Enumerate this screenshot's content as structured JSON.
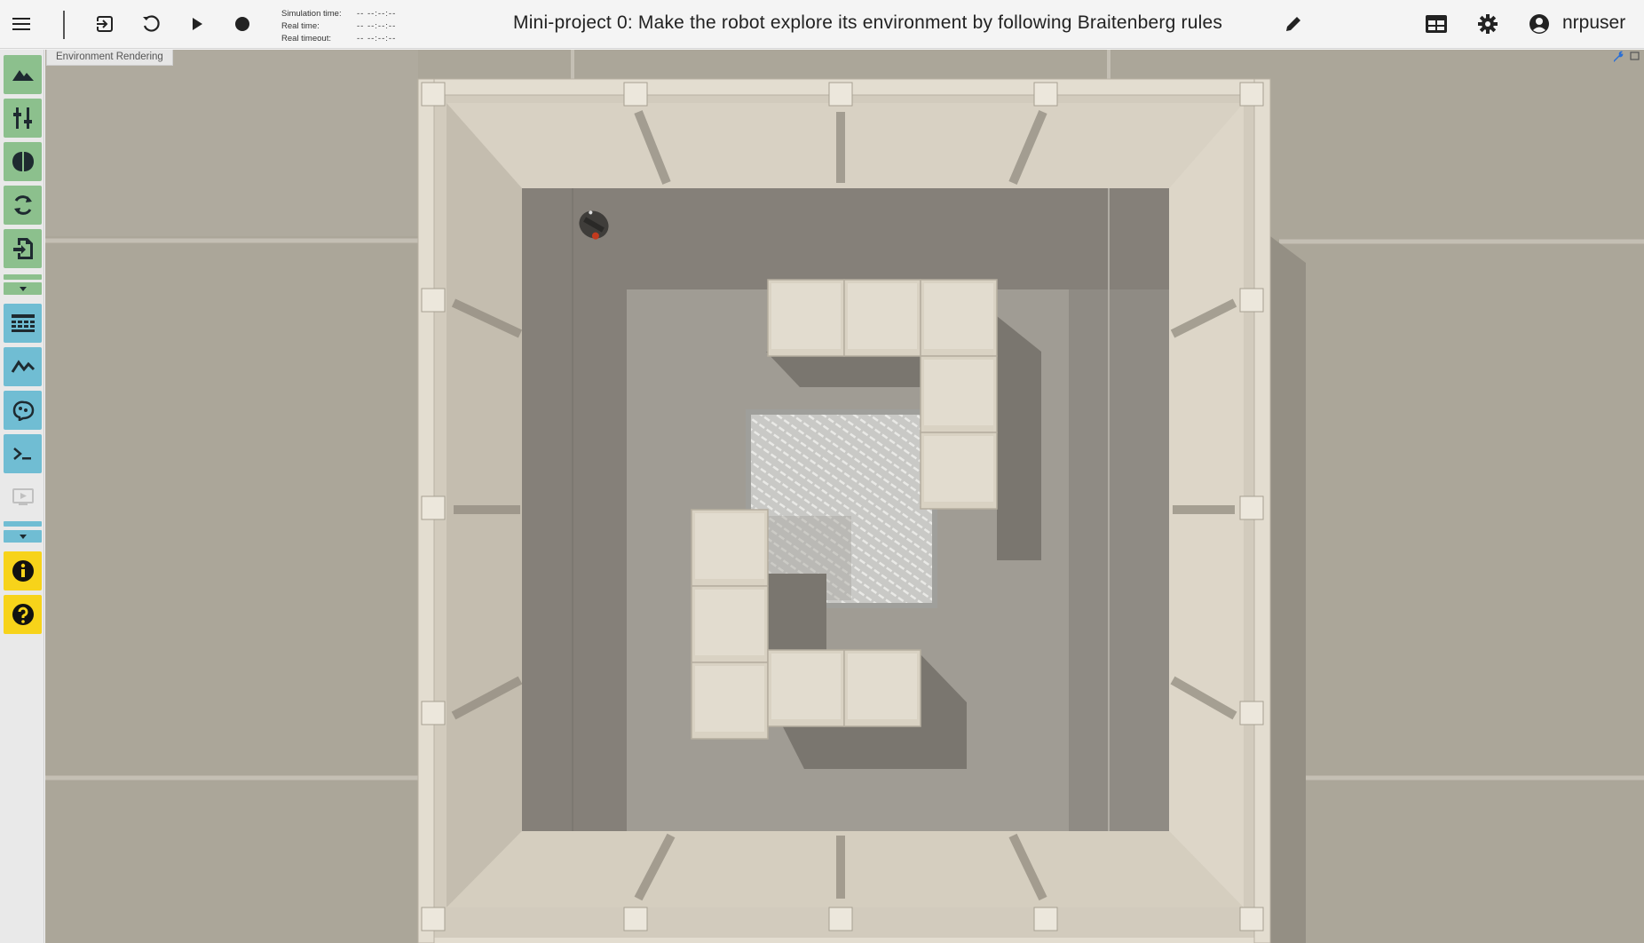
{
  "toolbar": {
    "menu_icon": "menu-icon",
    "exit_icon": "exit-icon",
    "reset_icon": "reset-icon",
    "play_icon": "play-icon",
    "record_icon": "record-icon"
  },
  "timers": {
    "simulation_label": "Simulation time:",
    "simulation_value": "-- --:--:--",
    "real_label": "Real time:",
    "real_value": "-- --:--:--",
    "timeout_label": "Real timeout:",
    "timeout_value": "-- --:--:--"
  },
  "experiment_title": "Mini-project 0: Make the robot explore its environment by following Braitenberg rules",
  "user": {
    "name": "nrpuser"
  },
  "viewport": {
    "tab_label": "Environment Rendering"
  },
  "sidebar": {
    "items": [
      {
        "name": "environment-icon",
        "color": "#8cc08d"
      },
      {
        "name": "object-inspector-icon",
        "color": "#8cc08d"
      },
      {
        "name": "brain-icon",
        "color": "#8cc08d"
      },
      {
        "name": "transfer-function-icon",
        "color": "#8cc08d"
      },
      {
        "name": "import-icon",
        "color": "#8cc08d"
      },
      {
        "name": "spike-train-icon",
        "color": "#70bdd3"
      },
      {
        "name": "joint-plot-icon",
        "color": "#70bdd3"
      },
      {
        "name": "brain-visualizer-icon",
        "color": "#70bdd3"
      },
      {
        "name": "terminal-icon",
        "color": "#70bdd3"
      },
      {
        "name": "info-icon",
        "color": "#f7d31a"
      },
      {
        "name": "help-icon",
        "color": "#f7d31a"
      }
    ]
  },
  "colors": {
    "green": "#8cc08d",
    "blue": "#70bdd3",
    "yellow": "#f7d31a"
  }
}
